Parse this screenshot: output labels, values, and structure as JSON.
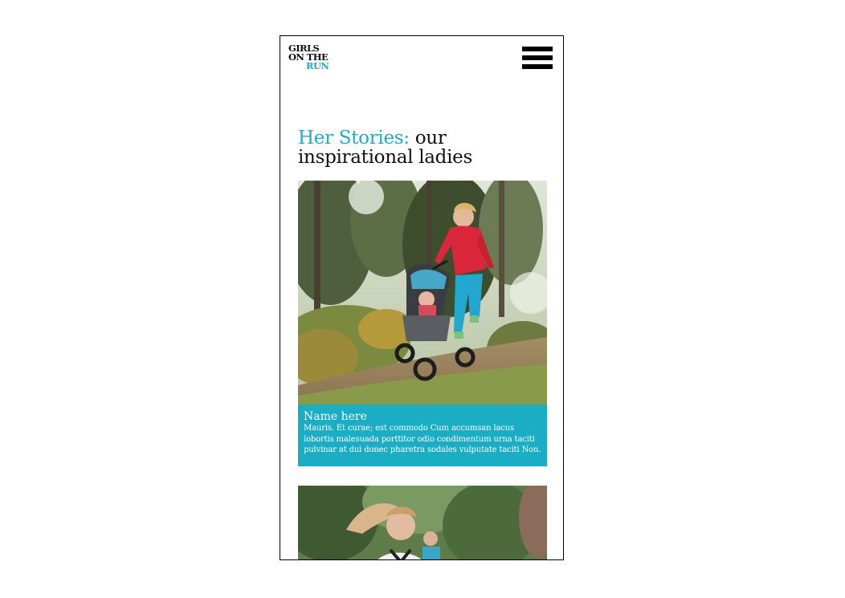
{
  "logo": {
    "line1": "GIRLS",
    "line2": "ON THE",
    "line3": "RUN"
  },
  "header": {
    "menu_icon": "hamburger-menu-icon"
  },
  "page": {
    "title_accent": "Her Stories:",
    "title_rest": " our inspirational ladies"
  },
  "stories": [
    {
      "photo": "woman-running-with-stroller-image",
      "name": "Name here",
      "body": "Mauris. Et curae; est commodo Cum accumsan lacus lobortis malesuada porttitor odio condimentum urna taciti pulvinar at dui donec pharetra sodales vulputate taciti Non."
    },
    {
      "photo": "women-running-on-trail-image"
    }
  ],
  "colors": {
    "accent": "#1aadc3",
    "text": "#111111",
    "background": "#ffffff"
  }
}
